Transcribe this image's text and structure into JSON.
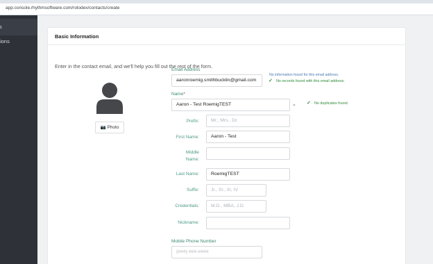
{
  "browser": {
    "url": "app.console.rhythmsoftware.com/rolodex/contacts/create"
  },
  "sidebar": {
    "items": [
      {
        "label": "s"
      },
      {
        "label": "tions"
      }
    ]
  },
  "card": {
    "title": "Basic Information",
    "intro": "Enter in the contact email, and we'll help you fill out the rest of the form."
  },
  "photo": {
    "label": "📷 Photo"
  },
  "email": {
    "label": "Email Address",
    "value": "aaronroemig.smithbucklin@gmail.com",
    "note_info": "No information found for this email address.",
    "note_records": "No records found with this email address."
  },
  "name": {
    "label": "Name",
    "required": "*",
    "value": "Aaron - Test RoemigTEST",
    "note": "No duplicates found."
  },
  "prefix": {
    "label": "Prefix:",
    "placeholder": "Mr., Mrs., Dr."
  },
  "first_name": {
    "label": "First Name:",
    "value": "Aaron - Test"
  },
  "middle_name": {
    "label_line1": "Middle",
    "label_line2": "Name:",
    "value": ""
  },
  "last_name": {
    "label": "Last Name:",
    "value": "RoemigTEST"
  },
  "suffix": {
    "label": "Suffix:",
    "placeholder": "Jr., Sr., III, IV"
  },
  "credentials": {
    "label": "Credentials:",
    "placeholder": "M.D., MBA, J.D."
  },
  "nickname": {
    "label": "Nickname:",
    "value": ""
  },
  "mobile": {
    "label": "Mobile Phone Number",
    "placeholder": "(###) ###-####"
  }
}
